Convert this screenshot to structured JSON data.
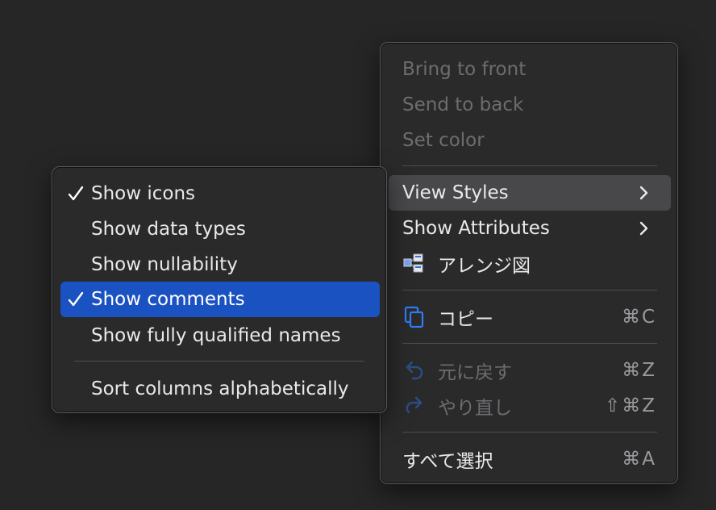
{
  "main_menu": {
    "items": [
      {
        "label": "Bring to front",
        "disabled": true
      },
      {
        "label": "Send to back",
        "disabled": true
      },
      {
        "label": "Set color",
        "disabled": true
      },
      {
        "label": "View Styles",
        "has_submenu": true,
        "highlighted": true
      },
      {
        "label": "Show Attributes",
        "has_submenu": true
      },
      {
        "label": "アレンジ図",
        "icon": "arrange-diagram-icon"
      },
      {
        "label": "コピー",
        "icon": "copy-icon",
        "shortcut": "⌘C"
      },
      {
        "label": "元に戻す",
        "icon": "undo-icon",
        "shortcut": "⌘Z",
        "disabled": true
      },
      {
        "label": "やり直し",
        "icon": "redo-icon",
        "shortcut": "⇧⌘Z",
        "disabled": true
      },
      {
        "label": "すべて選択",
        "shortcut": "⌘A"
      }
    ]
  },
  "sub_menu": {
    "items": [
      {
        "label": "Show icons",
        "checked": true
      },
      {
        "label": "Show data types",
        "checked": false
      },
      {
        "label": "Show nullability",
        "checked": false
      },
      {
        "label": "Show comments",
        "checked": true,
        "highlighted": true
      },
      {
        "label": "Show fully qualified names",
        "checked": false
      },
      {
        "label": "Sort columns alphabetically",
        "checked": false
      }
    ]
  },
  "colors": {
    "background": "#262626",
    "menu_bg": "#2a2a2b",
    "highlight_blue": "#1b52c2",
    "highlight_gray": "#48484a",
    "icon_blue": "#2f7bf5"
  }
}
